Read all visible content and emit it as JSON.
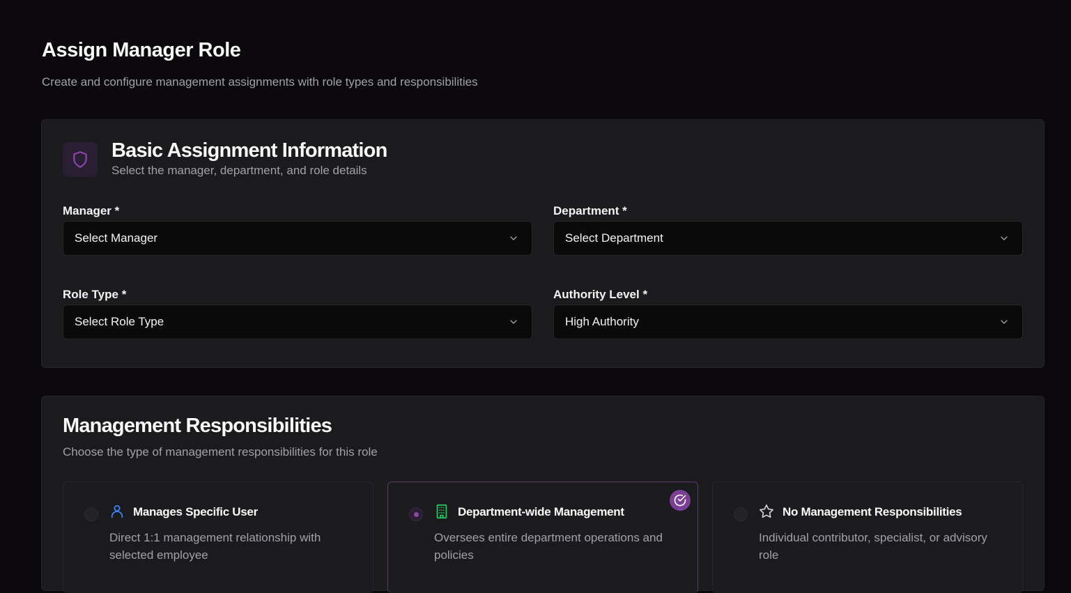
{
  "header": {
    "title": "Assign Manager Role",
    "subtitle": "Create and configure management assignments with role types and responsibilities"
  },
  "basic": {
    "icon": "shield-icon",
    "title": "Basic Assignment Information",
    "subtitle": "Select the manager, department, and role details",
    "fields": {
      "manager": {
        "label": "Manager *",
        "value": "Select Manager"
      },
      "department": {
        "label": "Department *",
        "value": "Select Department"
      },
      "role_type": {
        "label": "Role Type *",
        "value": "Select Role Type"
      },
      "authority": {
        "label": "Authority Level *",
        "value": "High Authority"
      }
    }
  },
  "responsibilities": {
    "title": "Management Responsibilities",
    "subtitle": "Choose the type of management responsibilities for this role",
    "options": [
      {
        "icon": "user-icon",
        "title": "Manages Specific User",
        "description": "Direct 1:1 management relationship with selected employee",
        "selected": false
      },
      {
        "icon": "building-icon",
        "title": "Department-wide Management",
        "description": "Oversees entire department operations and policies",
        "selected": true
      },
      {
        "icon": "star-icon",
        "title": "No Management Responsibilities",
        "description": "Individual contributor, specialist, or advisory role",
        "selected": false
      }
    ]
  },
  "colors": {
    "accent": "#8e44ad",
    "user_icon": "#3b82f6",
    "building_icon": "#22c55e",
    "background": "#0a080b",
    "card": "#1b1b1e"
  }
}
